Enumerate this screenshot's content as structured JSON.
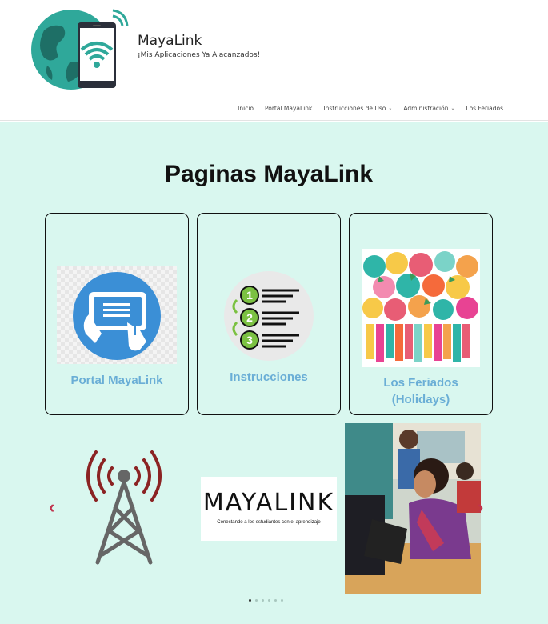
{
  "site": {
    "title": "MayaLink",
    "tagline": "¡Mis Aplicaciones Ya Alacanzados!"
  },
  "nav": {
    "items": [
      {
        "label": "Inicio"
      },
      {
        "label": "Portal MayaLink"
      },
      {
        "label": "Instrucciones de Uso",
        "has_dropdown": true
      },
      {
        "label": "Administración",
        "has_dropdown": true
      },
      {
        "label": "Los Feriados"
      }
    ]
  },
  "main": {
    "heading": "Paginas MayaLink",
    "cards": [
      {
        "label": "Portal MayaLink",
        "icon": "tablet-touch-icon"
      },
      {
        "label": "Instrucciones",
        "icon": "numbered-list-icon"
      },
      {
        "label_line1": "Los Feriados",
        "label_line2": "(Holidays)",
        "icon": "festive-decorations-image"
      }
    ]
  },
  "carousel": {
    "slides": [
      {
        "name": "radio-tower-icon"
      },
      {
        "brand_text": "MAYALINK",
        "caption": "Conectando a los estudiantes con el aprendizaje"
      },
      {
        "name": "student-laptop-photo"
      }
    ],
    "dot_count": 6,
    "active_index": 0
  },
  "colors": {
    "accent_bg": "#d9f7ef",
    "link_blue": "#6aaed6",
    "arrow_red": "#c0334d",
    "tower_red": "#8b2323"
  }
}
